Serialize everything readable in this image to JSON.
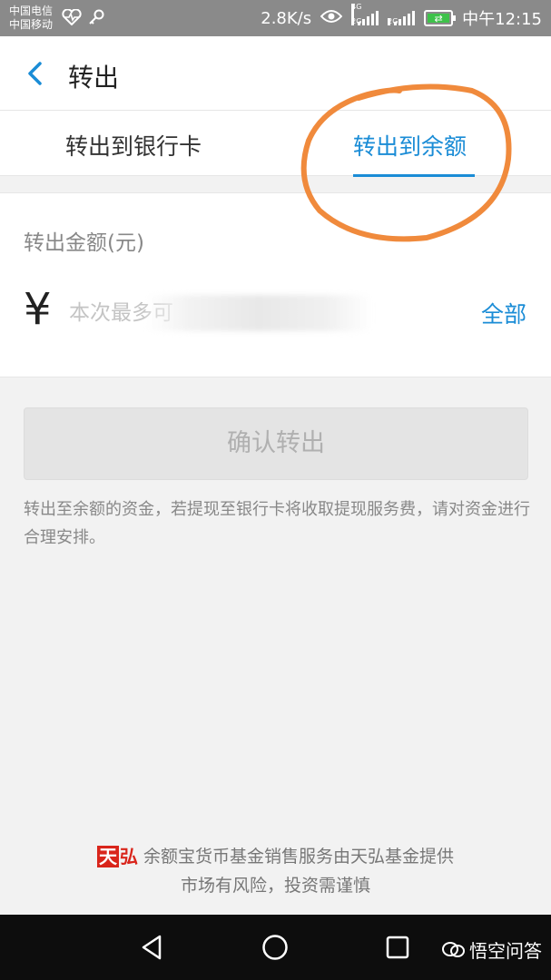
{
  "status_bar": {
    "carrier1": "中国电信",
    "carrier2": "中国移动",
    "net_speed": "2.8K/s",
    "sig1_tag": "4G",
    "sig1_sub": "2G",
    "sig2_tag": "2G",
    "time": "中午12:15",
    "icons": [
      "heartbeat-icon",
      "key-icon",
      "eye-icon",
      "signal-icon",
      "battery-charging-icon"
    ]
  },
  "header": {
    "title": "转出",
    "back_icon": "chevron-left-icon"
  },
  "tabs": [
    {
      "label": "转出到银行卡",
      "active": false
    },
    {
      "label": "转出到余额",
      "active": true
    }
  ],
  "amount": {
    "label": "转出金额(元)",
    "currency_symbol": "¥",
    "placeholder": "本次最多可",
    "all_button": "全部"
  },
  "confirm_button": "确认转出",
  "notice": "转出至余额的资金，若提现至银行卡将收取提现服务费，请对资金进行合理安排。",
  "footer": {
    "logo_char1": "天",
    "logo_char2": "弘",
    "line1": "余额宝货币基金销售服务由天弘基金提供",
    "line2": "市场有风险，投资需谨慎"
  },
  "watermark": {
    "text": "悟空问答"
  },
  "colors": {
    "accent": "#1a8cd6",
    "annotation": "#f08a3c",
    "logo_red": "#d9251b"
  }
}
